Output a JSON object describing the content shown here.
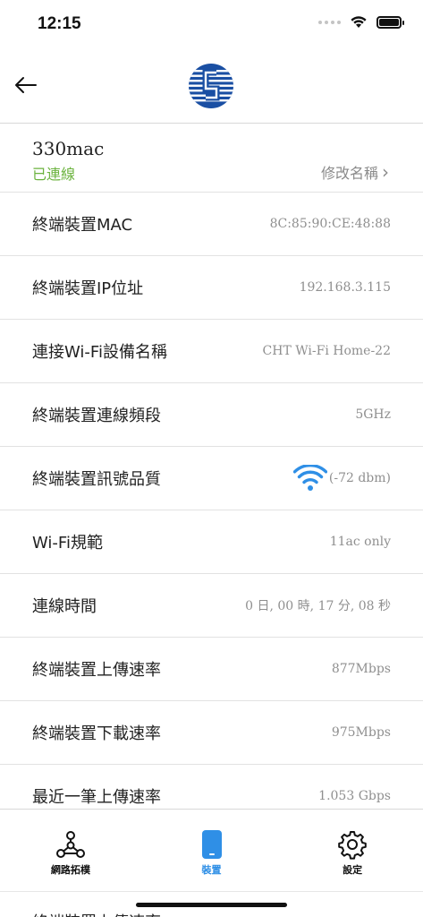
{
  "status": {
    "time": "12:15"
  },
  "device": {
    "name": "330mac",
    "status": "已連線",
    "rename_label": "修改名稱",
    "rename_chevron": "›"
  },
  "info_rows": [
    {
      "label": "終端裝置MAC",
      "value": "8C:85:90:CE:48:88"
    },
    {
      "label": "終端裝置IP位址",
      "value": "192.168.3.115"
    },
    {
      "label": "連接Wi-Fi設備名稱",
      "value": "CHT Wi-Fi Home-22"
    },
    {
      "label": "終端裝置連線頻段",
      "value": "5GHz"
    },
    {
      "label": "終端裝置訊號品質",
      "value": "(-72 dbm)",
      "icon": "wifi-signal-icon"
    },
    {
      "label": "Wi-Fi規範",
      "value": "11ac only"
    },
    {
      "label": "連線時間",
      "value": "0 日, 00 時, 17 分, 08 秒"
    },
    {
      "label": "終端裝置上傳速率",
      "value": "877Mbps"
    },
    {
      "label": "終端裝置下載速率",
      "value": "975Mbps"
    },
    {
      "label": "最近一筆上傳速率",
      "value": "1.053 Gbps"
    }
  ],
  "tabs": [
    {
      "label": "網路拓樸",
      "icon": "network-topology-icon",
      "active": false
    },
    {
      "label": "裝置",
      "icon": "phone-icon",
      "active": true
    },
    {
      "label": "設定",
      "icon": "gear-icon",
      "active": false
    }
  ],
  "colors": {
    "accent": "#2f8fe6",
    "connected": "#6cb33f",
    "logo": "#1a4fa3"
  },
  "peek_row": {
    "label": "終端裝置上傳速率"
  }
}
